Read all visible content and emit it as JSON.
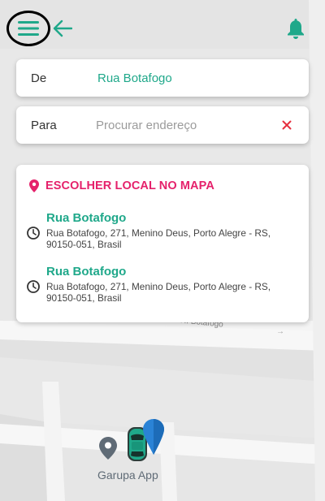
{
  "header": {
    "menu_icon": "menu-icon",
    "back_icon": "arrow-left-icon",
    "bell_icon": "bell-icon"
  },
  "route": {
    "from": {
      "label": "De",
      "value": "Rua Botafogo"
    },
    "to": {
      "label": "Para",
      "placeholder": "Procurar endereço",
      "clear_icon": "close-icon"
    }
  },
  "suggestions": {
    "pick_on_map": "ESCOLHER LOCAL NO MAPA",
    "items": [
      {
        "title": "Rua Botafogo",
        "address": "Rua Botafogo, 271, Menino Deus, Porto Alegre - RS, 90150-051, Brasil"
      },
      {
        "title": "Rua Botafogo",
        "address": "Rua Botafogo, 271, Menino Deus, Porto Alegre - RS, 90150-051, Brasil"
      }
    ]
  },
  "map": {
    "street_label": "R. Botafogo",
    "direction_arrow": "→",
    "marker_label": "Garupa App"
  },
  "colors": {
    "brand_green": "#1fa88a",
    "accent_pink": "#e5216b",
    "clear_red": "#e6303f",
    "marker_blue": "#2a83d6",
    "marker_grey": "#5f6b76"
  }
}
